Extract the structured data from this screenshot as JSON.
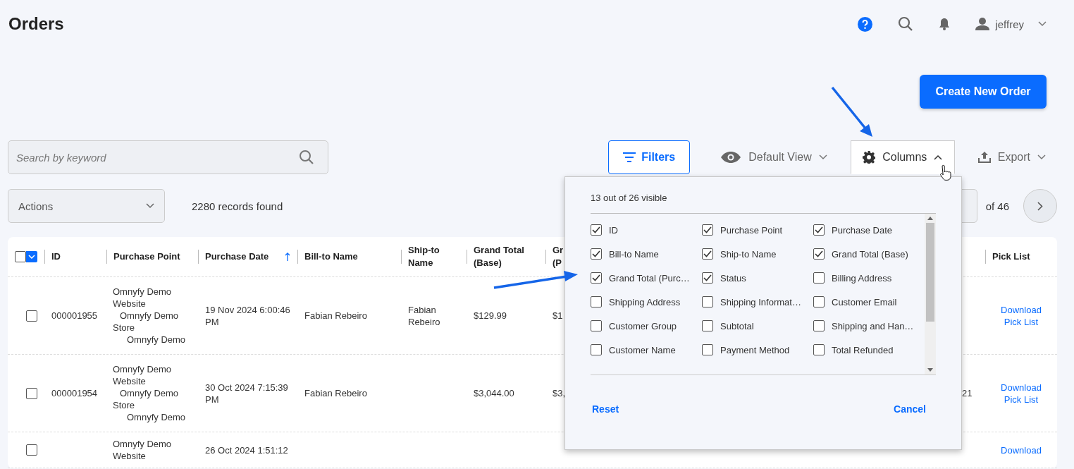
{
  "page": {
    "title": "Orders"
  },
  "top_bar": {
    "user": "jeffrey"
  },
  "create_button": "Create New Order",
  "search": {
    "placeholder": "Search by keyword"
  },
  "toolbar": {
    "filters": "Filters",
    "view": "Default View",
    "columns": {
      "label": "Columns",
      "expanded": true
    },
    "export": "Export"
  },
  "actions": {
    "placeholder": "Actions"
  },
  "records": "2280 records found",
  "pagination": {
    "of": "of 46"
  },
  "table": {
    "select_all": {
      "checked": false
    },
    "columns": [
      {
        "label": "ID",
        "sorted": false
      },
      {
        "label": "Purchase Point",
        "sorted": false
      },
      {
        "label": "Purchase Date",
        "sorted": true
      },
      {
        "label": "Bill-to Name",
        "sorted": false
      },
      {
        "label": "Ship-to Name",
        "sorted": false
      },
      {
        "label": "Grand Total (Base)",
        "sorted": false
      },
      {
        "label": "Gr (P",
        "sorted": false
      },
      {
        "label": "Pick List",
        "sorted": false
      }
    ],
    "rows": [
      {
        "selected": false,
        "id": "000001955",
        "purchase_point": {
          "name": "Omnyfy Demo Website",
          "children": [
            {
              "name": "Omnyfy Demo Store",
              "children": [
                {
                  "name": "Omnyfy Demo"
                }
              ]
            }
          ]
        },
        "purchase_date": "19 Nov 2024 6:00:46 PM",
        "bill_to": "Fabian Rebeiro",
        "ship_to": "Fabian Rebeiro",
        "grand_total_base": "$129.99",
        "column_8": "$1",
        "pick_list": "Download Pick List"
      },
      {
        "selected": false,
        "id": "000001954",
        "purchase_point": {
          "name": "Omnyfy Demo Website",
          "children": [
            {
              "name": "Omnyfy Demo Store",
              "children": [
                {
                  "name": "Omnyfy Demo"
                }
              ]
            }
          ]
        },
        "purchase_date": "30 Oct 2024 7:15:39 PM",
        "bill_to": "Fabian Rebeiro",
        "grand_total_base": "$3,044.00",
        "column_8": "$3,",
        "column_10": "21",
        "pick_list": "Download Pick List"
      },
      {
        "selected": false,
        "purchase_point": {
          "name": "Omnyfy Demo Website"
        },
        "purchase_date": "26 Oct 2024 1:51:12",
        "pick_list": "Download"
      }
    ]
  },
  "columns_popup": {
    "summary": "13 out of 26 visible",
    "options": [
      {
        "label": "ID",
        "checked": true
      },
      {
        "label": "Purchase Point",
        "checked": true
      },
      {
        "label": "Purchase Date",
        "checked": true
      },
      {
        "label": "Bill-to Name",
        "checked": true
      },
      {
        "label": "Ship-to Name",
        "checked": true
      },
      {
        "label": "Grand Total (Base)",
        "checked": true
      },
      {
        "label": "Grand Total (Purc…",
        "checked": true
      },
      {
        "label": "Status",
        "checked": true
      },
      {
        "label": "Billing Address",
        "checked": false
      },
      {
        "label": "Shipping Address",
        "checked": false
      },
      {
        "label": "Shipping Informat…",
        "checked": false
      },
      {
        "label": "Customer Email",
        "checked": false
      },
      {
        "label": "Customer Group",
        "checked": false
      },
      {
        "label": "Subtotal",
        "checked": false
      },
      {
        "label": "Shipping and Han…",
        "checked": false
      },
      {
        "label": "Customer Name",
        "checked": false
      },
      {
        "label": "Payment Method",
        "checked": false
      },
      {
        "label": "Total Refunded",
        "checked": false
      }
    ],
    "reset": "Reset",
    "cancel": "Cancel"
  }
}
